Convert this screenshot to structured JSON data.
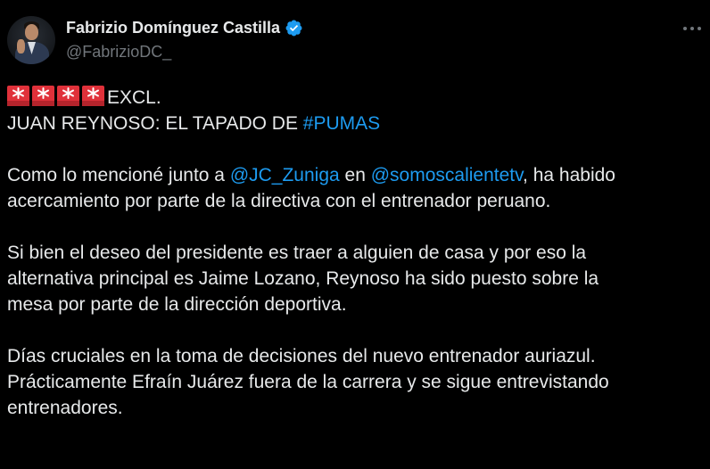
{
  "author": {
    "display_name": "Fabrizio Domínguez Castilla",
    "handle": "@FabrizioDC_",
    "verified": true
  },
  "icons": {
    "avatar": "profile-photo",
    "verified": "verified-badge-icon",
    "more": "more-options-icon",
    "siren": "police-siren-emoji"
  },
  "colors": {
    "background": "#000000",
    "text": "#e7e9ea",
    "muted": "#71767b",
    "link": "#1d9bf0",
    "siren": "#e0313a"
  },
  "tweet": {
    "line1_text": "EXCL.",
    "line2_prefix": "JUAN REYNOSO: EL TAPADO DE ",
    "line2_hashtag": "#PUMAS",
    "p1_l1_a": "Como lo mencioné junto a ",
    "p1_l1_mention1": "@JC_Zuniga",
    "p1_l1_b": " en ",
    "p1_l1_mention2": "@somoscalientetv",
    "p1_l1_c": ", ha habido",
    "p1_l2": "acercamiento por parte de la directiva con el entrenador peruano.",
    "p2_l1": "Si bien el deseo del presidente es traer a alguien de casa y por eso la",
    "p2_l2": "alternativa principal es Jaime Lozano, Reynoso ha sido puesto sobre la",
    "p2_l3": "mesa por parte de la dirección deportiva.",
    "p3_l1": "Días cruciales en la toma de decisiones del nuevo entrenador auriazul.",
    "p3_l2": "Prácticamente Efraín Juárez fuera de la carrera y se sigue entrevistando",
    "p3_l3": "entrenadores."
  }
}
